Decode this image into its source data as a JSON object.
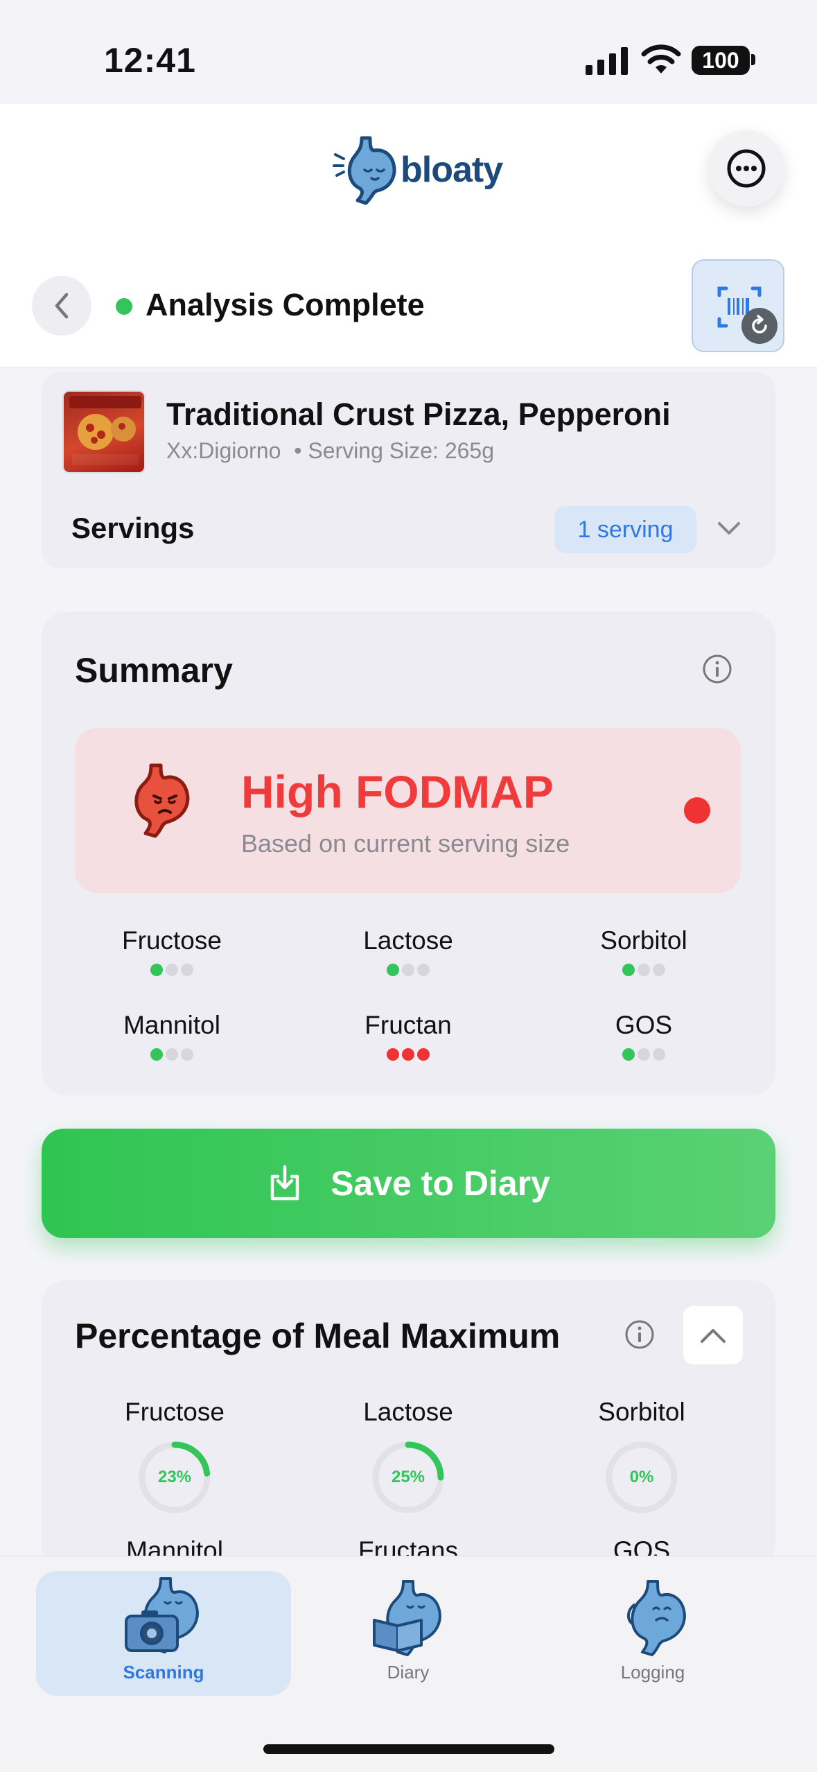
{
  "status_bar": {
    "time": "12:41",
    "battery": "100"
  },
  "header": {
    "app_name": "bloaty"
  },
  "nav": {
    "status": "Analysis Complete"
  },
  "product": {
    "name": "Traditional Crust Pizza, Pepperoni",
    "brand": "Xx:Digiorno",
    "serving_size": "• Serving Size: 265g",
    "servings_label": "Servings",
    "serving_value": "1 serving"
  },
  "summary": {
    "title": "Summary",
    "level": "High FODMAP",
    "subtitle": "Based on current serving size",
    "level_color": "#ef3232",
    "nutrients": [
      {
        "name": "Fructose",
        "level": 1,
        "color": "green"
      },
      {
        "name": "Lactose",
        "level": 1,
        "color": "green"
      },
      {
        "name": "Sorbitol",
        "level": 1,
        "color": "green"
      },
      {
        "name": "Mannitol",
        "level": 1,
        "color": "green"
      },
      {
        "name": "Fructan",
        "level": 3,
        "color": "red"
      },
      {
        "name": "GOS",
        "level": 1,
        "color": "green"
      }
    ]
  },
  "save_button": {
    "label": "Save to Diary"
  },
  "meal_max": {
    "title": "Percentage of Meal Maximum",
    "items": [
      {
        "name": "Fructose",
        "percent": 23,
        "label": "23%"
      },
      {
        "name": "Lactose",
        "percent": 25,
        "label": "25%"
      },
      {
        "name": "Sorbitol",
        "percent": 0,
        "label": "0%"
      }
    ],
    "row2": [
      "Mannitol",
      "Fructans",
      "GOS"
    ]
  },
  "tabs": [
    {
      "label": "Scanning",
      "active": true,
      "icon": "stomach-camera-icon"
    },
    {
      "label": "Diary",
      "active": false,
      "icon": "stomach-book-icon"
    },
    {
      "label": "Logging",
      "active": false,
      "icon": "stomach-sad-icon"
    }
  ],
  "colors": {
    "accent": "#2f7ae0",
    "success": "#33c559",
    "danger": "#ef3232"
  }
}
